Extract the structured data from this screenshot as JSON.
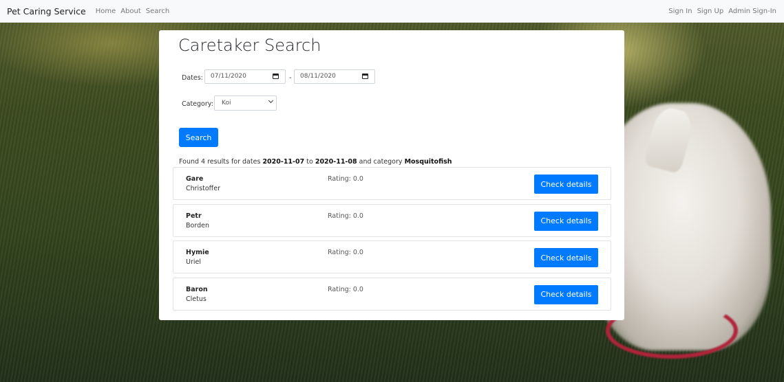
{
  "nav": {
    "brand": "Pet Caring Service",
    "links": [
      "Home",
      "About",
      "Search"
    ],
    "right_links": [
      "Sign In",
      "Sign Up",
      "Admin Sign-In"
    ]
  },
  "search": {
    "title": "Caretaker Search",
    "dates_label": "Dates:",
    "start_date": "07/11/2020",
    "date_separator": "-",
    "end_date": "08/11/2020",
    "category_label": "Category:",
    "category_selected": "Koi",
    "search_button": "Search"
  },
  "summary": {
    "prefix": "Found 4 results for dates",
    "from": "2020-11-07",
    "to_word": "to",
    "to": "2020-11-08",
    "category_word": "and category",
    "category": "Mosquitofish"
  },
  "results": [
    {
      "first": "Gare",
      "last": "Christoffer",
      "rating": "Rating: 0.0",
      "button": "Check details"
    },
    {
      "first": "Petr",
      "last": "Borden",
      "rating": "Rating: 0.0",
      "button": "Check details"
    },
    {
      "first": "Hymie",
      "last": "Uriel",
      "rating": "Rating: 0.0",
      "button": "Check details"
    },
    {
      "first": "Baron",
      "last": "Cletus",
      "rating": "Rating: 0.0",
      "button": "Check details"
    }
  ],
  "colors": {
    "primary": "#007bff",
    "navbar_bg": "#f8f9fa"
  }
}
